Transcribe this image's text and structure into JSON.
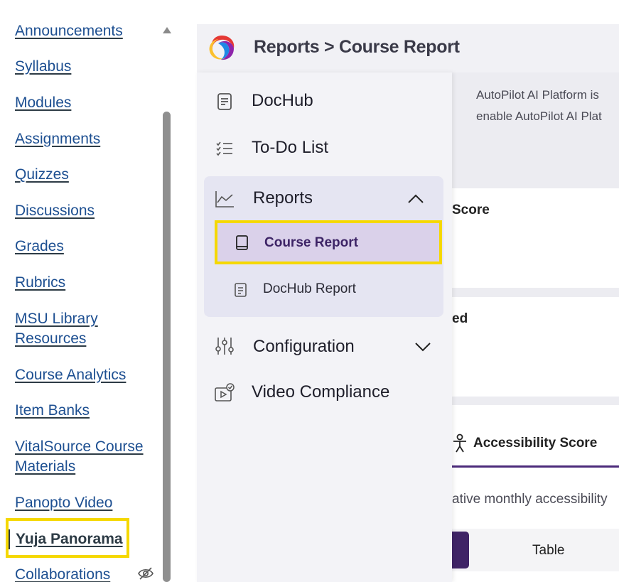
{
  "course_nav": {
    "items": [
      {
        "label": "Announcements"
      },
      {
        "label": "Syllabus"
      },
      {
        "label": "Modules"
      },
      {
        "label": "Assignments"
      },
      {
        "label": "Quizzes"
      },
      {
        "label": "Discussions"
      },
      {
        "label": "Grades"
      },
      {
        "label": "Rubrics"
      },
      {
        "label": "MSU Library Resources"
      },
      {
        "label": "Course Analytics"
      },
      {
        "label": "Item Banks"
      },
      {
        "label": "VitalSource Course Materials"
      },
      {
        "label": "Panopto Video"
      },
      {
        "label": "Yuja Panorama"
      },
      {
        "label": "Collaborations"
      }
    ]
  },
  "header": {
    "breadcrumb": "Reports > Course Report"
  },
  "background": {
    "notice_line1": "AutoPilot AI Platform is",
    "notice_line2": "enable AutoPilot AI Plat",
    "card1_title": "Score",
    "card2_title": "ed",
    "tab_label": "Accessibility Score",
    "description": "ative monthly accessibility",
    "table_button": "Table"
  },
  "menu": {
    "items": {
      "dochub": "DocHub",
      "todo": "To-Do List",
      "reports": "Reports",
      "configuration": "Configuration",
      "video": "Video Compliance"
    },
    "reports_sub": {
      "course_report": "Course Report",
      "dochub_report": "DocHub Report"
    }
  },
  "colors": {
    "accent": "#4b2a7a",
    "highlight": "#f5d800",
    "link": "#1d4f91"
  }
}
